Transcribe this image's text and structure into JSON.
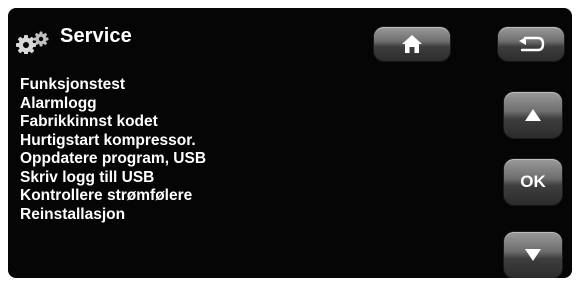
{
  "header": {
    "title": "Service",
    "title_icon": "gears-icon"
  },
  "menu": {
    "items": [
      {
        "label": "Funksjonstest"
      },
      {
        "label": "Alarmlogg"
      },
      {
        "label": "Fabrikkinnst kodet"
      },
      {
        "label": "Hurtigstart kompressor."
      },
      {
        "label": "Oppdatere program, USB"
      },
      {
        "label": "Skriv logg till USB"
      },
      {
        "label": "Kontrollere strømfølere"
      },
      {
        "label": "Reinstallasjon"
      }
    ]
  },
  "controls": {
    "home_icon": "home-icon",
    "back_icon": "back-arrow-icon",
    "up_icon": "arrow-up-icon",
    "ok_label": "OK",
    "down_icon": "arrow-down-icon"
  },
  "colors": {
    "screen_background": "#050505",
    "text": "#ffffff",
    "button": "#6e6e6e"
  }
}
